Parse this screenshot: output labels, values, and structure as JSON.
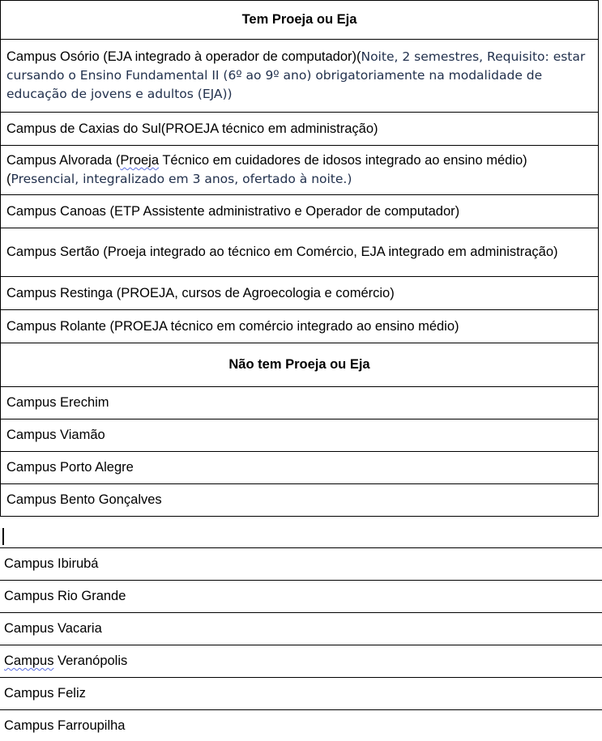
{
  "section_yes": {
    "title": "Tem Proeja ou Eja",
    "rows": [
      {
        "text": "Campus Osório (EJA integrado à operador de computador)(",
        "blue": "Noite, 2 semestres, Requisito: estar cursando o Ensino Fundamental II (6º ao 9º ano) obrigatoriamente na modalidade de educação de jovens e adultos (EJA))"
      },
      {
        "text": "Campus de Caxias do Sul(PROEJA técnico em administração)"
      },
      {
        "text_a": "Campus Alvorada (",
        "squiggle": "Proeja",
        "text_b": " Técnico em cuidadores de idosos integrado ao ensino médio)(",
        "blue": "Presencial, integralizado em 3 anos, ofertado à noite.)"
      },
      {
        "text": "Campus Canoas (ETP Assistente administrativo e Operador de computador)"
      },
      {
        "text": "Campus Sertão (Proeja integrado ao técnico em Comércio, EJA integrado em administração)"
      },
      {
        "text": "Campus Restinga (PROEJA, cursos de Agroecologia e comércio)"
      },
      {
        "text": "Campus Rolante (PROEJA técnico em comércio integrado ao ensino médio)"
      }
    ]
  },
  "section_no": {
    "title": "Não tem Proeja ou Eja",
    "rows": [
      "Campus Erechim",
      "Campus Viamão",
      "Campus Porto Alegre",
      "Campus Bento Gonçalves"
    ]
  },
  "extra_list": {
    "rows": [
      {
        "text": "Campus Ibirubá"
      },
      {
        "text": "Campus Rio Grande"
      },
      {
        "text": "Campus Vacaria"
      },
      {
        "squiggle": "Campus",
        "text": " Veranópolis"
      },
      {
        "text": "Campus Feliz"
      },
      {
        "text": "Campus Farroupilha"
      }
    ]
  }
}
